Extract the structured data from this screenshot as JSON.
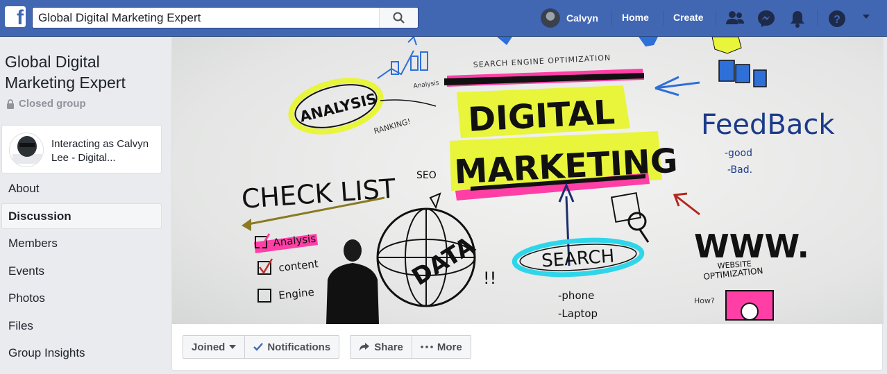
{
  "topbar": {
    "logo_glyph": "f",
    "search_value": "Global Digital Marketing Expert",
    "user_name": "Calvyn",
    "home_label": "Home",
    "create_label": "Create",
    "icons": [
      "friends-icon",
      "messenger-icon",
      "notifications-icon",
      "help-icon",
      "account-menu-caret-icon"
    ]
  },
  "group": {
    "title": "Global Digital Marketing Expert",
    "privacy": "Closed group",
    "interacting_as": "Interacting as Calvyn Lee - Digital..."
  },
  "sidebar": {
    "items": [
      {
        "label": "About",
        "active": false
      },
      {
        "label": "Discussion",
        "active": true
      },
      {
        "label": "Members",
        "active": false
      },
      {
        "label": "Events",
        "active": false
      },
      {
        "label": "Photos",
        "active": false
      },
      {
        "label": "Files",
        "active": false
      },
      {
        "label": "Group Insights",
        "active": false
      }
    ]
  },
  "cover": {
    "headline_1": "DIGITAL",
    "headline_2": "MARKETING",
    "seo_caption": "SEARCH ENGINE OPTIMIZATION",
    "analysis": "ANALYSIS",
    "ranking": "RANKING!",
    "analysis_small": "Analysis",
    "feedback": "FeedBack",
    "good": "-good",
    "bad": "-Bad.",
    "checklist": "CHECK LIST",
    "seo": "SEO",
    "check_items": [
      "Analysis",
      "content",
      "Engine"
    ],
    "data": "DATA",
    "exclaim": "!!",
    "search": "SEARCH",
    "phone": "-phone",
    "laptop": "-Laptop",
    "www": "WWW.",
    "website": "WEBSITE",
    "optimization": "OPTIMIZATION",
    "how": "How?"
  },
  "actions": {
    "joined": "Joined",
    "notifications": "Notifications",
    "share": "Share",
    "more": "More"
  },
  "colors": {
    "brand": "#4267b2",
    "yellow": "#e8f53a",
    "pink": "#ff3fa6",
    "cyan": "#2fd6ea"
  }
}
